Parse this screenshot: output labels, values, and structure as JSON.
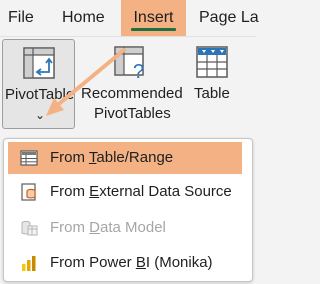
{
  "menubar": {
    "tabs": [
      {
        "label": "File"
      },
      {
        "label": "Home"
      },
      {
        "label": "Insert"
      },
      {
        "label": "Page La"
      }
    ]
  },
  "ribbon": {
    "pivottable_label": "PivotTable",
    "recommended_line1": "Recommended",
    "recommended_line2": "PivotTables",
    "table_label": "Table",
    "dropdown_chevron": "⌄"
  },
  "dropdown": {
    "items": [
      {
        "pre": "From ",
        "key": "T",
        "post": "able/Range"
      },
      {
        "pre": "From ",
        "key": "E",
        "post": "xternal Data Source"
      },
      {
        "pre": "From ",
        "key": "D",
        "post": "ata Model"
      },
      {
        "pre": "From Power ",
        "key": "B",
        "post": "I (Monika)"
      }
    ]
  },
  "colors": {
    "highlight": "#f4b183",
    "accent_green": "#1e7145",
    "icon_blue": "#2e75b6",
    "icon_orange": "#c55a11"
  }
}
